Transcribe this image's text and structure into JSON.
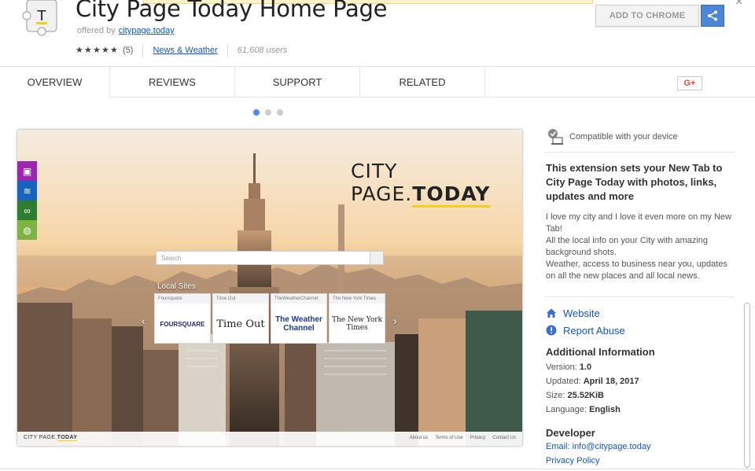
{
  "header": {
    "title": "City Page Today Home Page",
    "offered_by_label": "offered by",
    "offered_by_link": "citypage.today",
    "rating_count": "(5)",
    "rating": 4.5,
    "category": "News & Weather",
    "users": "61,608 users",
    "add_button": "ADD TO CHROME",
    "close": "×"
  },
  "tabs": [
    {
      "label": "OVERVIEW"
    },
    {
      "label": "REVIEWS"
    },
    {
      "label": "SUPPORT"
    },
    {
      "label": "RELATED"
    }
  ],
  "gplus_label": "G+",
  "screenshot": {
    "logo_prefix": "CITY PAGE.",
    "logo_suffix": "TODAY",
    "search_placeholder": "Search",
    "local_sites_title": "Local Sites",
    "tiles": [
      {
        "head": "Foursquare",
        "body": "FOURSQUARE"
      },
      {
        "head": "Time Out",
        "body": "Time Out"
      },
      {
        "head": "TheWeatherChannel",
        "body": "The Weather Channel"
      },
      {
        "head": "The New York Times",
        "body": "The New York Times"
      }
    ],
    "footer_logo_prefix": "CITY PAGE.",
    "footer_logo_suffix": "TODAY",
    "footer_links": [
      "About us",
      "Terms of Use",
      "Privacy",
      "Contact Us"
    ]
  },
  "sidebar": {
    "compatible": "Compatible with your device",
    "description_bold": "This extension sets your New Tab to City Page Today with photos, links, updates and more",
    "description_body": "I love my city and I love it even more on my New Tab!\nAll the local info on your City with amazing background shots.\nWeather, access to business near you, updates on all the new places and all local news.",
    "website": "Website",
    "report_abuse": "Report Abuse",
    "additional_info_title": "Additional Information",
    "version_label": "Version:",
    "version_value": "1.0",
    "updated_label": "Updated:",
    "updated_value": "April 18, 2017",
    "size_label": "Size:",
    "size_value": "25.52KiB",
    "language_label": "Language:",
    "language_value": "English",
    "developer_title": "Developer",
    "email_label": "Email:",
    "email_value": "info@citypage.today",
    "privacy_policy": "Privacy Policy"
  },
  "colors": {
    "link": "#1155cc",
    "share_blue": "#4e86d6",
    "active_dot": "#4a8af4",
    "side_icon_1": "#9b27b0",
    "side_icon_2": "#1565c0",
    "side_icon_3": "#2e7d32",
    "side_icon_4": "#7cb342"
  }
}
